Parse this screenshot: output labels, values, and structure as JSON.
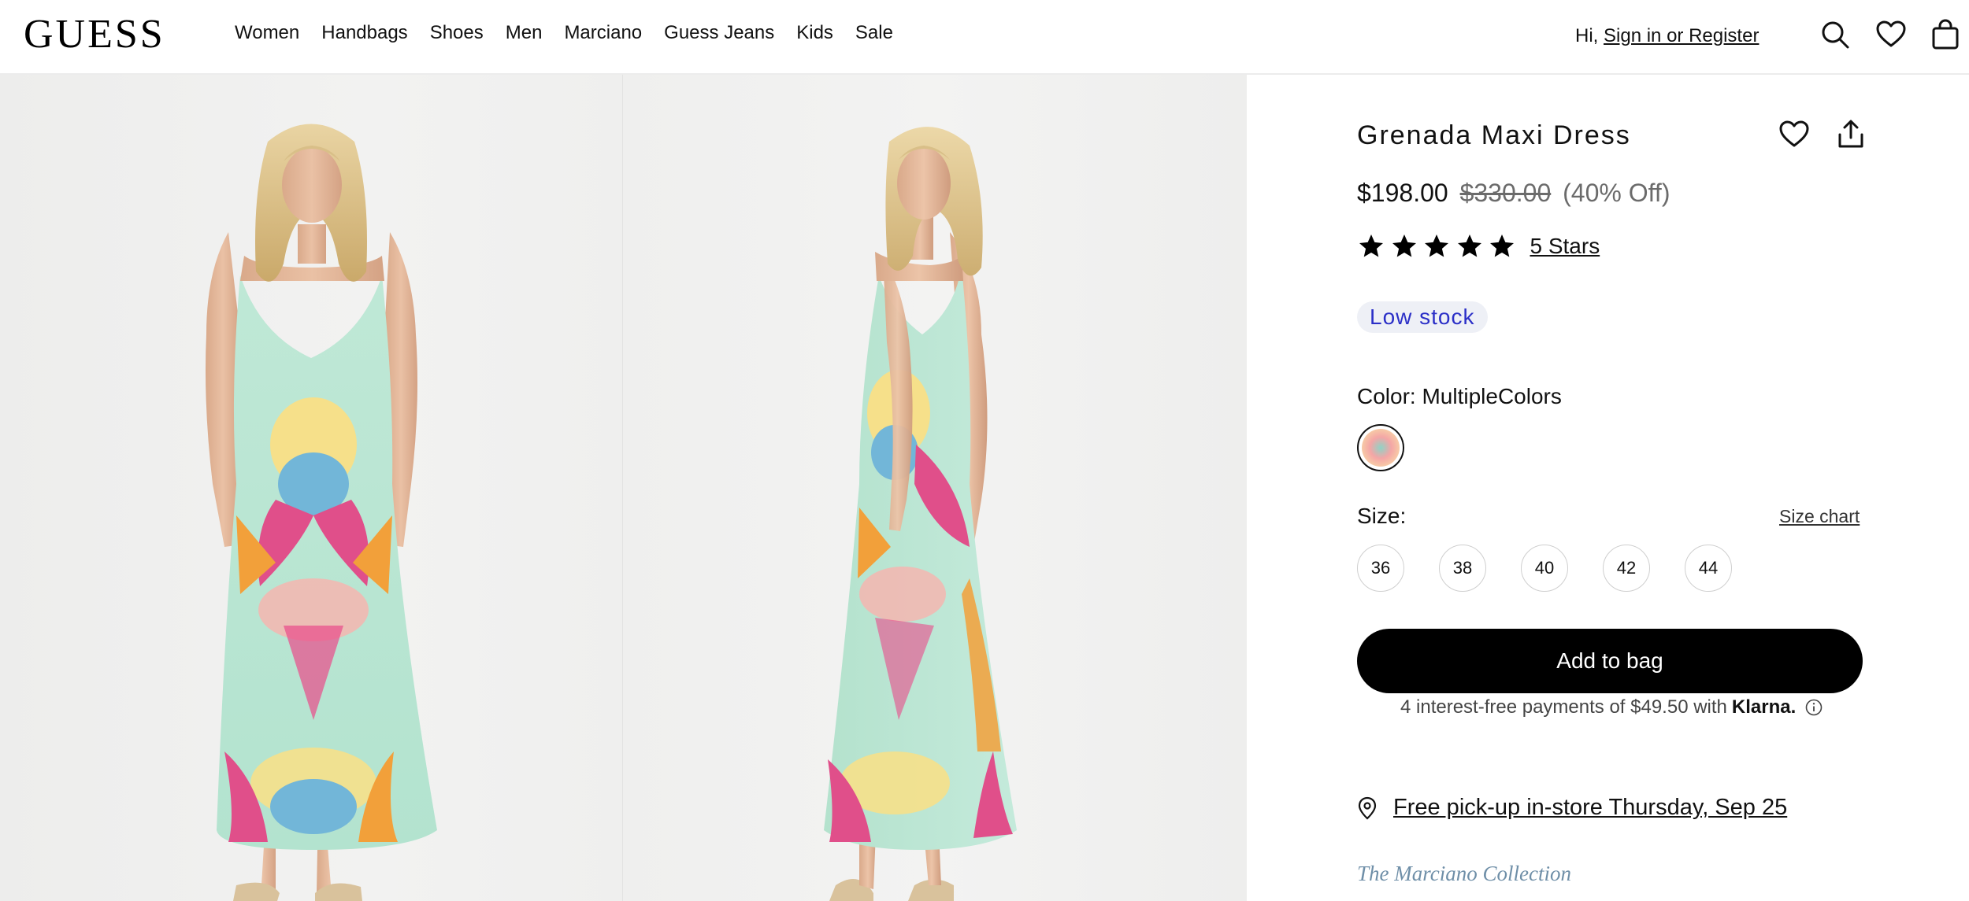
{
  "header": {
    "logo": "GUESS",
    "nav": [
      "Women",
      "Handbags",
      "Shoes",
      "Men",
      "Marciano",
      "Guess Jeans",
      "Kids",
      "Sale"
    ],
    "greeting_prefix": "Hi,",
    "signin_label": "Sign in or Register",
    "icons": [
      "search-icon",
      "heart-icon",
      "shopping-bag-icon"
    ]
  },
  "product": {
    "title": "Grenada Maxi Dress",
    "price_now": "$198.00",
    "price_was": "$330.00",
    "price_off": "(40% Off)",
    "rating": 5,
    "rating_label": "5 Stars",
    "stock": "Low stock",
    "color_label": "Color: MultipleColors",
    "size_label": "Size:",
    "size_chart": "Size chart",
    "sizes": [
      "36",
      "38",
      "40",
      "42",
      "44"
    ],
    "add_to_bag": "Add to bag",
    "klarna_text": "4 interest-free payments of $49.50 with",
    "klarna_brand": "Klarna.",
    "pickup": "Free pick-up in-store Thursday, Sep 25",
    "collection": "The Marciano Collection"
  },
  "colors": {
    "accent": "#000000",
    "stock_text": "#2b2fc7",
    "stock_bg": "#eef0f6",
    "collection_text": "#6f8fa8",
    "dress_mint": "#b9e6d3",
    "dress_pink": "#e04f8a",
    "dress_orange": "#f2a03a"
  }
}
